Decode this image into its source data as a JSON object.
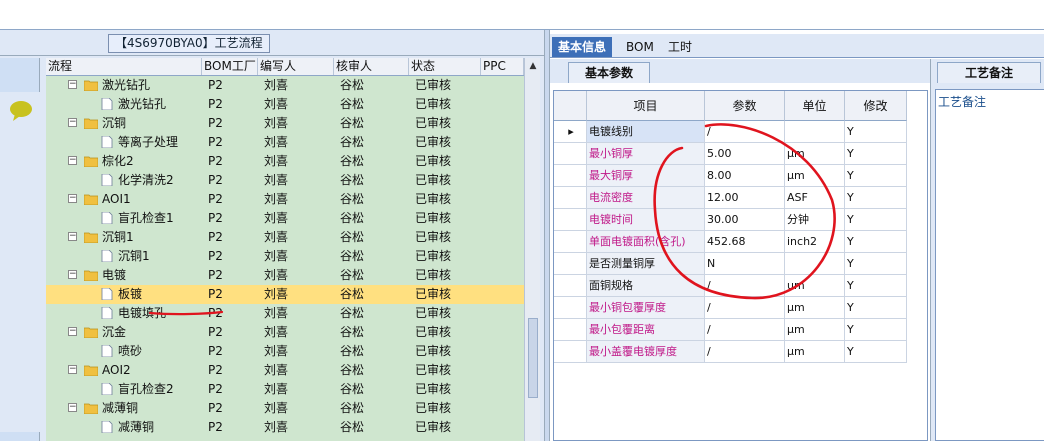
{
  "flow_title": "【4S6970BYA0】工艺流程",
  "grid": {
    "headers": [
      "流程",
      "BOM工厂",
      "编写人",
      "核审人",
      "状态",
      "PPC"
    ],
    "rows": [
      {
        "level": 1,
        "label": "激光钻孔",
        "plant": "P2",
        "writer": "刘喜",
        "reviewer": "谷松",
        "status": "已审核"
      },
      {
        "level": 2,
        "label": "激光钻孔",
        "plant": "P2",
        "writer": "刘喜",
        "reviewer": "谷松",
        "status": "已审核"
      },
      {
        "level": 1,
        "label": "沉铜",
        "plant": "P2",
        "writer": "刘喜",
        "reviewer": "谷松",
        "status": "已审核"
      },
      {
        "level": 2,
        "label": "等离子处理",
        "plant": "P2",
        "writer": "刘喜",
        "reviewer": "谷松",
        "status": "已审核"
      },
      {
        "level": 1,
        "label": "棕化2",
        "plant": "P2",
        "writer": "刘喜",
        "reviewer": "谷松",
        "status": "已审核"
      },
      {
        "level": 2,
        "label": "化学清洗2",
        "plant": "P2",
        "writer": "刘喜",
        "reviewer": "谷松",
        "status": "已审核"
      },
      {
        "level": 1,
        "label": "AOI1",
        "plant": "P2",
        "writer": "刘喜",
        "reviewer": "谷松",
        "status": "已审核"
      },
      {
        "level": 2,
        "label": "盲孔检查1",
        "plant": "P2",
        "writer": "刘喜",
        "reviewer": "谷松",
        "status": "已审核"
      },
      {
        "level": 1,
        "label": "沉铜1",
        "plant": "P2",
        "writer": "刘喜",
        "reviewer": "谷松",
        "status": "已审核"
      },
      {
        "level": 2,
        "label": "沉铜1",
        "plant": "P2",
        "writer": "刘喜",
        "reviewer": "谷松",
        "status": "已审核"
      },
      {
        "level": 1,
        "label": "电镀",
        "plant": "P2",
        "writer": "刘喜",
        "reviewer": "谷松",
        "status": "已审核"
      },
      {
        "level": 2,
        "label": "板镀",
        "plant": "P2",
        "writer": "刘喜",
        "reviewer": "谷松",
        "status": "已审核",
        "selected": true
      },
      {
        "level": 2,
        "label": "电镀填孔",
        "plant": "P2",
        "writer": "刘喜",
        "reviewer": "谷松",
        "status": "已审核"
      },
      {
        "level": 1,
        "label": "沉金",
        "plant": "P2",
        "writer": "刘喜",
        "reviewer": "谷松",
        "status": "已审核"
      },
      {
        "level": 2,
        "label": "喷砂",
        "plant": "P2",
        "writer": "刘喜",
        "reviewer": "谷松",
        "status": "已审核"
      },
      {
        "level": 1,
        "label": "AOI2",
        "plant": "P2",
        "writer": "刘喜",
        "reviewer": "谷松",
        "status": "已审核"
      },
      {
        "level": 2,
        "label": "盲孔检查2",
        "plant": "P2",
        "writer": "刘喜",
        "reviewer": "谷松",
        "status": "已审核"
      },
      {
        "level": 1,
        "label": "减薄铜",
        "plant": "P2",
        "writer": "刘喜",
        "reviewer": "谷松",
        "status": "已审核"
      },
      {
        "level": 2,
        "label": "减薄铜",
        "plant": "P2",
        "writer": "刘喜",
        "reviewer": "谷松",
        "status": "已审核"
      }
    ]
  },
  "right_tabs": [
    "基本信息",
    "BOM",
    "工时"
  ],
  "subtab": "基本参数",
  "remark_tab": "工艺备注",
  "remark_label": "工艺备注",
  "props": {
    "headers": [
      "项目",
      "参数",
      "单位",
      "修改"
    ],
    "rows": [
      {
        "name": "电镀线别",
        "value": "/",
        "unit": "",
        "edit": "Y",
        "red": false
      },
      {
        "name": "最小铜厚",
        "value": "5.00",
        "unit": "μm",
        "edit": "Y",
        "red": true
      },
      {
        "name": "最大铜厚",
        "value": "8.00",
        "unit": "μm",
        "edit": "Y",
        "red": true
      },
      {
        "name": "电流密度",
        "value": "12.00",
        "unit": "ASF",
        "edit": "Y",
        "red": true
      },
      {
        "name": "电镀时间",
        "value": "30.00",
        "unit": "分钟",
        "edit": "Y",
        "red": true
      },
      {
        "name": "单面电镀面积(含孔)",
        "value": "452.68",
        "unit": "inch2",
        "edit": "Y",
        "red": true
      },
      {
        "name": "是否测量铜厚",
        "value": "N",
        "unit": "",
        "edit": "Y",
        "red": false
      },
      {
        "name": "面铜规格",
        "value": "/",
        "unit": "um",
        "edit": "Y",
        "red": false
      },
      {
        "name": "最小铜包覆厚度",
        "value": "/",
        "unit": "μm",
        "edit": "Y",
        "red": true
      },
      {
        "name": "最小包覆距离",
        "value": "/",
        "unit": "μm",
        "edit": "Y",
        "red": true
      },
      {
        "name": "最小盖覆电镀厚度",
        "value": "/",
        "unit": "μm",
        "edit": "Y",
        "red": true
      }
    ]
  },
  "colors": {
    "accent": "#3d6fb8",
    "highlight_row": "#ffe080",
    "red_text": "#c01888",
    "annotation": "#e0141e"
  }
}
